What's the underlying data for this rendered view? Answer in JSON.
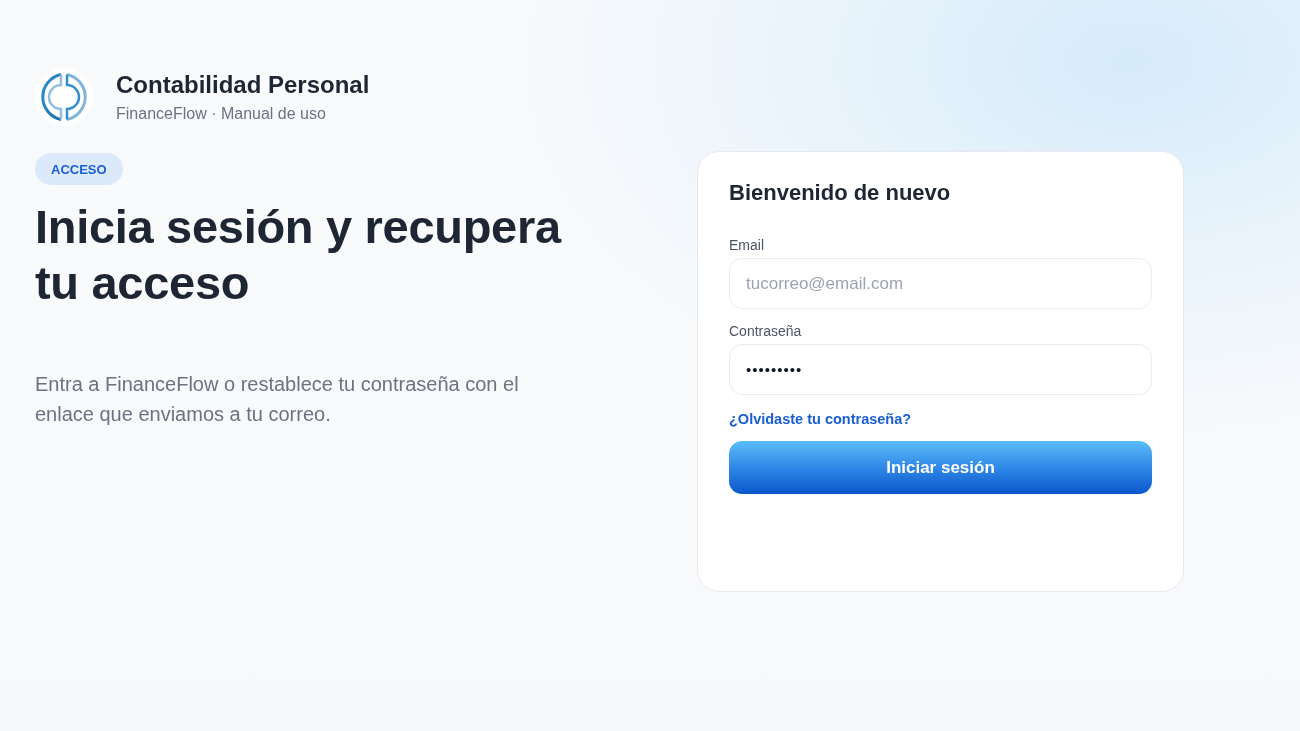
{
  "brand": {
    "title": "Contabilidad Personal",
    "subtitle": "FinanceFlow · Manual de uso"
  },
  "hero": {
    "badge": "ACCESO",
    "heading": "Inicia sesión y recupera tu acceso",
    "description": "Entra a FinanceFlow o restablece tu contraseña con el enlace que enviamos a tu correo."
  },
  "login_card": {
    "title": "Bienvenido de nuevo",
    "fields": [
      {
        "label": "Email",
        "placeholder": "tucorreo@email.com"
      },
      {
        "label": "Contraseña",
        "value": "•••••••••"
      }
    ],
    "forgot_link": "¿Olvidaste tu contraseña?",
    "submit_button": "Iniciar sesión"
  }
}
